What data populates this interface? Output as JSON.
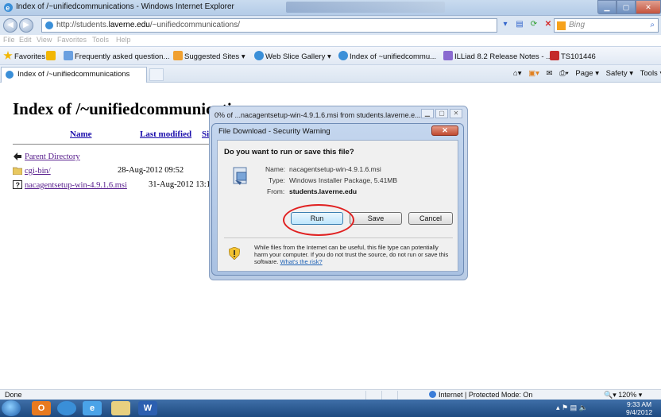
{
  "window": {
    "title": "Index of /~unifiedcommunications - Windows Internet Explorer",
    "controls": [
      "minimize",
      "maximize",
      "close"
    ]
  },
  "address_bar": {
    "url_prefix": "http://students.",
    "url_domain": "laverne.edu",
    "url_suffix": "/~unifiedcommunications/",
    "search_placeholder": "Bing"
  },
  "menu": {
    "items": [
      "File",
      "Edit",
      "View",
      "Favorites",
      "Tools",
      "Help"
    ]
  },
  "favorites_bar": {
    "favorites_label": "Favorites",
    "items": [
      "Frequently asked question...",
      "Suggested Sites ▾",
      "Web Slice Gallery ▾",
      "Index of ~unifiedcommu...",
      "ILLiad 8.2 Release Notes - ...",
      "TS101446"
    ]
  },
  "tab": {
    "label": "Index of /~unifiedcommunications"
  },
  "command_bar": {
    "page_label": "Page ▾",
    "safety_label": "Safety ▾",
    "tools_label": "Tools ▾"
  },
  "page": {
    "heading": "Index of /~unifiedcommunications",
    "columns": [
      "Name",
      "Last modified",
      "Size"
    ],
    "rows": [
      {
        "name": "Parent Directory",
        "modified": "",
        "icon": "back-arrow-icon"
      },
      {
        "name": "cgi-bin/",
        "modified": "28-Aug-2012 09:52",
        "icon": "folder-icon"
      },
      {
        "name": "nacagentsetup-win-4.9.1.6.msi",
        "modified": "31-Aug-2012 13:12 5",
        "icon": "unknown-file-icon"
      }
    ]
  },
  "download_progress": {
    "title": "0% of ...nacagentsetup-win-4.9.1.6.msi from students.laverne.e..."
  },
  "dialog": {
    "title": "File Download - Security Warning",
    "question": "Do you want to run or save this file?",
    "name_label": "Name:",
    "name_value": "nacagentsetup-win-4.9.1.6.msi",
    "type_label": "Type:",
    "type_value": "Windows Installer Package, 5.41MB",
    "from_label": "From:",
    "from_value": "students.laverne.edu",
    "run_label": "Run",
    "save_label": "Save",
    "cancel_label": "Cancel",
    "warning_text": "While files from the Internet can be useful, this file type can potentially harm your computer. If you do not trust the source, do not run or save this software.",
    "risk_link": "What's the risk?"
  },
  "status_bar": {
    "status": "Done",
    "zone": "Internet | Protected Mode: On",
    "zoom": "120%"
  },
  "taskbar": {
    "time": "9:33 AM",
    "date": "9/4/2012"
  },
  "colors": {
    "link": "#551a8b",
    "annotation_ring": "#e02020",
    "taskbar": "#1e4a80"
  }
}
